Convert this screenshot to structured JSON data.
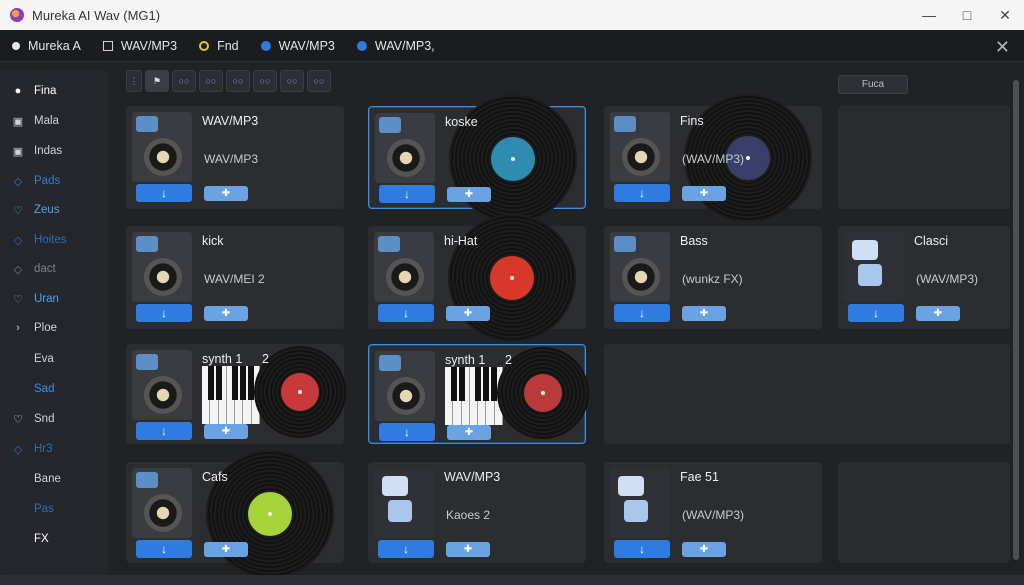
{
  "window": {
    "title": "Mureka AI Wav (MG1)"
  },
  "tabs": [
    {
      "label": "Mureka A",
      "icon": "dot-icon"
    },
    {
      "label": "WAV/MP3",
      "icon": "square-icon"
    },
    {
      "label": "Fnd",
      "icon": "circle-icon"
    },
    {
      "label": "WAV/MP3",
      "icon": "globe-icon"
    },
    {
      "label": "WAV/MP3,",
      "icon": "globe-icon"
    }
  ],
  "sidebar": {
    "items": [
      {
        "label": "Fina",
        "icon": "●",
        "color": "#ffffff"
      },
      {
        "label": "Mala",
        "icon": "▣",
        "color": "#cfd2d8"
      },
      {
        "label": "Indas",
        "icon": "▣",
        "color": "#cfd2d8"
      },
      {
        "label": "Pads",
        "icon": "◇",
        "color": "#2f7fd0"
      },
      {
        "label": "Zeus",
        "icon": "♡",
        "color": "#4aa6f0"
      },
      {
        "label": "Hoites",
        "icon": "◇",
        "color": "#2a6fb6"
      },
      {
        "label": "dact",
        "icon": "◇",
        "color": "#7a8089"
      },
      {
        "label": "Uran",
        "icon": "♡",
        "color": "#4aa6f0"
      },
      {
        "label": "Ploe",
        "icon": "›",
        "color": "#cfd2d8"
      },
      {
        "label": "Eva",
        "icon": "",
        "color": "#cfd2d8"
      },
      {
        "label": "Sad",
        "icon": "",
        "color": "#3d8be0"
      },
      {
        "label": "Snd",
        "icon": "♡",
        "color": "#cfd2d8"
      },
      {
        "label": "Hr3",
        "icon": "◇",
        "color": "#2a6fb6"
      },
      {
        "label": "Bane",
        "icon": "",
        "color": "#cfd2d8"
      },
      {
        "label": "Pas",
        "icon": "",
        "color": "#2a6fb6"
      },
      {
        "label": "FX",
        "icon": "",
        "color": "#ffffff"
      }
    ]
  },
  "toolbar": {
    "search_label": "Fuca"
  },
  "cards": [
    {
      "title": "WAV/MP3",
      "subtitle": "WAV/MP3",
      "label_color": "#2b2b2b",
      "variant": "plain",
      "selected": false
    },
    {
      "title": "koske",
      "subtitle": "",
      "label_color": "#2f8bb0",
      "variant": "vinyl",
      "selected": true
    },
    {
      "title": "Fins",
      "subtitle": "(WAV/MP3)",
      "label_color": "#3a3f6a",
      "variant": "vinyl",
      "selected": false
    },
    {
      "title": "kick",
      "subtitle": "WAV/MEI 2",
      "label_color": "#2b2b2b",
      "variant": "plain",
      "selected": false
    },
    {
      "title": "hi-Hat",
      "subtitle": "",
      "label_color": "#d8382c",
      "variant": "vinyl",
      "selected": false
    },
    {
      "title": "Bass",
      "subtitle": "(wunkz FX)",
      "label_color": "#2b2b2b",
      "variant": "plain",
      "selected": false
    },
    {
      "title": "Clasci",
      "subtitle": "(WAV/MP3)",
      "label_color": "#2b2b2b",
      "variant": "chat",
      "selected": false
    },
    {
      "title": "synth 1",
      "title_num": "2",
      "subtitle": "",
      "label_color": "#c83a3a",
      "variant": "piano",
      "selected": false
    },
    {
      "title": "synth 1",
      "title_num": "2",
      "subtitle": "",
      "label_color": "#b83a3a",
      "variant": "piano",
      "selected": true
    },
    {
      "title": "Cafs",
      "subtitle": "",
      "label_color": "#a6d23a",
      "variant": "vinyl",
      "selected": false
    },
    {
      "title": "WAV/MP3",
      "subtitle": "Kaoes 2",
      "label_color": "#2b2b2b",
      "variant": "chat",
      "selected": false
    },
    {
      "title": "Fae 51",
      "subtitle": "(WAV/MP3)",
      "label_color": "#2b2b2b",
      "variant": "chat",
      "selected": false
    }
  ],
  "colors": {
    "accent": "#2f7be0",
    "selected_border": "#3f8fdc",
    "background": "#202226"
  }
}
